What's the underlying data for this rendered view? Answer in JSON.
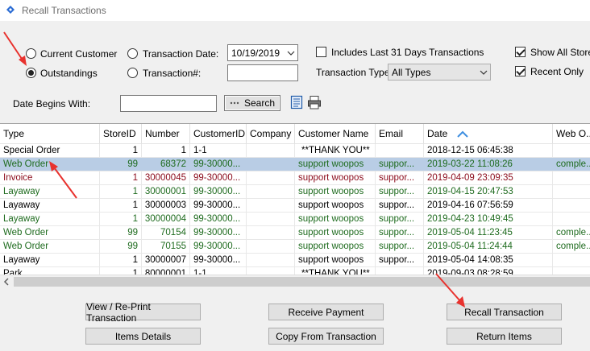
{
  "window": {
    "title": "Recall Transactions"
  },
  "filters": {
    "current_customer": "Current Customer",
    "outstandings": "Outstandings",
    "transaction_date_label": "Transaction Date:",
    "transaction_date_value": "10/19/2019",
    "transaction_no_label": "Transaction#:",
    "transaction_no_value": "",
    "includes_last_31": "Includes Last 31 Days Transactions",
    "transaction_type_label": "Transaction Type:",
    "transaction_type_value": "All Types",
    "show_all_stores": "Show All Stores",
    "recent_only": "Recent Only",
    "date_begins_label": "Date Begins With:",
    "date_begins_value": "",
    "search_button": "Search",
    "selected_radio": "Outstandings",
    "includes_last_31_checked": false,
    "show_all_stores_checked": true,
    "recent_only_checked": true
  },
  "grid": {
    "columns": [
      "Type",
      "StoreID",
      "Number",
      "CustomerID",
      "Company",
      "Customer Name",
      "Email",
      "Date",
      "Web O..."
    ],
    "sort_column": "Date",
    "rows": [
      {
        "type": "Special Order",
        "store": "1",
        "number": "1",
        "customer_id": "1-1",
        "company": "",
        "name": "**THANK YOU**",
        "email": "",
        "date": "2018-12-15 06:45:38",
        "web": "",
        "color": "#000000"
      },
      {
        "type": "Web Order",
        "store": "99",
        "number": "68372",
        "customer_id": "99-30000...",
        "company": "",
        "name": "support woopos",
        "email": "suppor...",
        "date": "2019-03-22 11:08:26",
        "web": "comple...",
        "color": "#1e6b1e"
      },
      {
        "type": "Invoice",
        "store": "1",
        "number": "30000045",
        "customer_id": "99-30000...",
        "company": "",
        "name": "support woopos",
        "email": "suppor...",
        "date": "2019-04-09 23:09:35",
        "web": "",
        "color": "#8b0a1a"
      },
      {
        "type": "Layaway",
        "store": "1",
        "number": "30000001",
        "customer_id": "99-30000...",
        "company": "",
        "name": "support woopos",
        "email": "suppor...",
        "date": "2019-04-15 20:47:53",
        "web": "",
        "color": "#1e6b1e"
      },
      {
        "type": "Layaway",
        "store": "1",
        "number": "30000003",
        "customer_id": "99-30000...",
        "company": "",
        "name": "support woopos",
        "email": "suppor...",
        "date": "2019-04-16 07:56:59",
        "web": "",
        "color": "#000000"
      },
      {
        "type": "Layaway",
        "store": "1",
        "number": "30000004",
        "customer_id": "99-30000...",
        "company": "",
        "name": "support woopos",
        "email": "suppor...",
        "date": "2019-04-23 10:49:45",
        "web": "",
        "color": "#1e6b1e"
      },
      {
        "type": "Web Order",
        "store": "99",
        "number": "70154",
        "customer_id": "99-30000...",
        "company": "",
        "name": "support woopos",
        "email": "suppor...",
        "date": "2019-05-04 11:23:45",
        "web": "comple...",
        "color": "#1e6b1e"
      },
      {
        "type": "Web Order",
        "store": "99",
        "number": "70155",
        "customer_id": "99-30000...",
        "company": "",
        "name": "support woopos",
        "email": "suppor...",
        "date": "2019-05-04 11:24:44",
        "web": "comple...",
        "color": "#1e6b1e"
      },
      {
        "type": "Layaway",
        "store": "1",
        "number": "30000007",
        "customer_id": "99-30000...",
        "company": "",
        "name": "support woopos",
        "email": "suppor...",
        "date": "2019-05-04 14:08:35",
        "web": "",
        "color": "#000000"
      },
      {
        "type": "Park",
        "store": "1",
        "number": "80000001",
        "customer_id": "1-1",
        "company": "",
        "name": "**THANK YOU**",
        "email": "",
        "date": "2019-09-03 08:28:59",
        "web": "",
        "color": "#000000"
      }
    ],
    "selected_row": 1
  },
  "buttons": {
    "view_reprint": "View / Re-Print Transaction",
    "receive_payment": "Receive Payment",
    "recall_transaction": "Recall Transaction",
    "items_details": "Items Details",
    "copy_from": "Copy From Transaction",
    "return_items": "Return Items"
  },
  "colors": {
    "annotation_arrow": "#e8322e",
    "selected_row": "#b9cde5",
    "sort_arrow": "#3d8ee0"
  }
}
